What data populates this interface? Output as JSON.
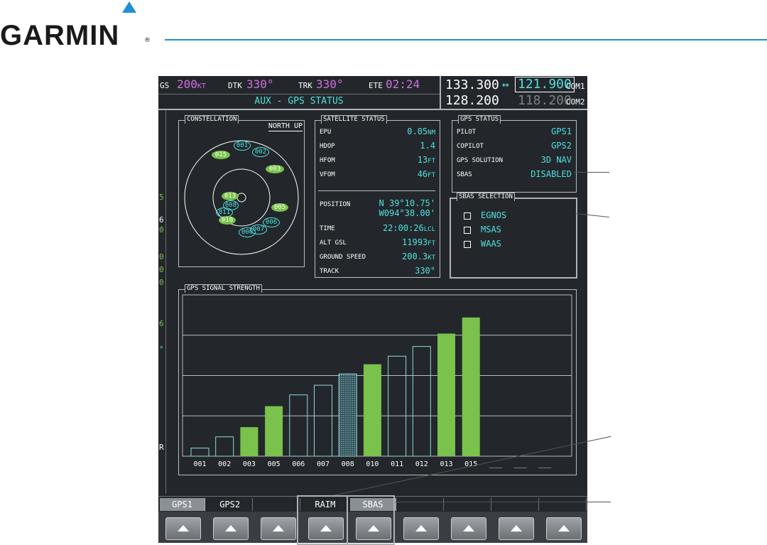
{
  "brand": {
    "name": "GARMIN",
    "reg": "®"
  },
  "top_bar": {
    "gs_label": "GS",
    "gs_value": "200",
    "gs_unit": "KT",
    "dtk_label": "DTK",
    "dtk_value": "330°",
    "trk_label": "TRK",
    "trk_value": "330°",
    "ete_label": "ETE",
    "ete_value": "02:24",
    "page_title": "AUX - GPS STATUS"
  },
  "radios": {
    "com1_active": "133.300",
    "com1_standby": "121.900",
    "com1_label": "COM1",
    "swap_icon": "↔",
    "com2_active": "128.200",
    "com2_standby": "118.200",
    "com2_label": "COM2"
  },
  "left_strip": [
    "5",
    "6",
    "0",
    "0",
    "0",
    "0",
    "6",
    "°",
    "R"
  ],
  "constellation": {
    "title": "CONSTELLATION",
    "orientation": "NORTH UP",
    "satellites": [
      {
        "id": "001",
        "style": "outline"
      },
      {
        "id": "002",
        "style": "outline"
      },
      {
        "id": "015",
        "style": "filled"
      },
      {
        "id": "003",
        "style": "filled"
      },
      {
        "id": "013",
        "style": "filled"
      },
      {
        "id": "008",
        "style": "outline"
      },
      {
        "id": "011",
        "style": "outline"
      },
      {
        "id": "010",
        "style": "filled"
      },
      {
        "id": "005",
        "style": "filled"
      },
      {
        "id": "006",
        "style": "outline"
      },
      {
        "id": "007",
        "style": "outline"
      },
      {
        "id": "000",
        "style": "outline"
      }
    ]
  },
  "satellite_status": {
    "title": "SATELLITE STATUS",
    "rows": [
      {
        "label": "EPU",
        "value": "0.05",
        "unit": "NM"
      },
      {
        "label": "HDOP",
        "value": "1.4",
        "unit": ""
      },
      {
        "label": "HFOM",
        "value": "13",
        "unit": "FT"
      },
      {
        "label": "VFOM",
        "value": "46",
        "unit": "FT"
      }
    ],
    "position_label": "POSITION",
    "position_lat": "N 39°10.75'",
    "position_lon": "W094°38.00'",
    "rows2": [
      {
        "label": "TIME",
        "value": "22:00:26",
        "unit": "LCL"
      },
      {
        "label": "ALT GSL",
        "value": "11993",
        "unit": "FT"
      },
      {
        "label": "GROUND SPEED",
        "value": "200.3",
        "unit": "KT"
      },
      {
        "label": "TRACK",
        "value": "330°",
        "unit": ""
      }
    ]
  },
  "gps_status": {
    "title": "GPS STATUS",
    "rows": [
      {
        "label": "PILOT",
        "value": "GPS1"
      },
      {
        "label": "COPILOT",
        "value": "GPS2"
      },
      {
        "label": "GPS SOLUTION",
        "value": "3D NAV"
      },
      {
        "label": "SBAS",
        "value": "DISABLED"
      }
    ]
  },
  "sbas_selection": {
    "title": "SBAS SELECTION",
    "options": [
      "EGNOS",
      "MSAS",
      "WAAS"
    ]
  },
  "signal_strength": {
    "title": "GPS SIGNAL STRENGTH"
  },
  "chart_data": {
    "type": "bar",
    "categories": [
      "001",
      "002",
      "003",
      "005",
      "006",
      "007",
      "008",
      "010",
      "011",
      "012",
      "013",
      "015",
      "___",
      "___",
      "___"
    ],
    "values": [
      0.05,
      0.12,
      0.18,
      0.31,
      0.38,
      0.44,
      0.51,
      0.57,
      0.62,
      0.68,
      0.76,
      0.86,
      0,
      0,
      0
    ],
    "styles": [
      "outline",
      "outline",
      "filled",
      "filled",
      "outline",
      "outline",
      "hatched",
      "filled",
      "outline",
      "outline",
      "filled",
      "filled",
      "none",
      "none",
      "none"
    ],
    "ylim": [
      0,
      1
    ],
    "grid": true,
    "colors": {
      "filled": "#7ac24b",
      "outline": "#8fd8e0",
      "hatched": "#5b8f99"
    }
  },
  "softkeys": {
    "labels": [
      "GPS1",
      "GPS2",
      "",
      "RAIM",
      "SBAS",
      "",
      "",
      "",
      "",
      "",
      "",
      ""
    ],
    "button_count": 9
  }
}
